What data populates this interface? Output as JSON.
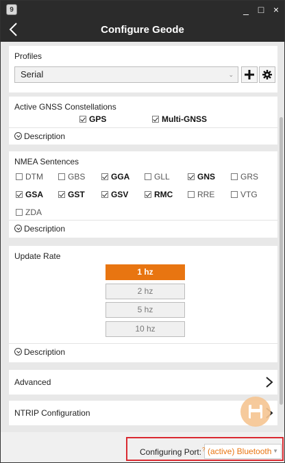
{
  "window": {
    "title": "Configure Geode",
    "app_icon_label": "9",
    "minimize": "_",
    "maximize": "□",
    "close": "×"
  },
  "profiles": {
    "title": "Profiles",
    "selected": "Serial"
  },
  "gnss": {
    "title": "Active GNSS Constellations",
    "options": [
      {
        "label": "GPS",
        "checked": true
      },
      {
        "label": "Multi-GNSS",
        "checked": true
      }
    ],
    "description": "Description"
  },
  "nmea": {
    "title": "NMEA Sentences",
    "options": [
      {
        "label": "DTM",
        "checked": false
      },
      {
        "label": "GBS",
        "checked": false
      },
      {
        "label": "GGA",
        "checked": true
      },
      {
        "label": "GLL",
        "checked": false
      },
      {
        "label": "GNS",
        "checked": true
      },
      {
        "label": "GRS",
        "checked": false
      },
      {
        "label": "GSA",
        "checked": true
      },
      {
        "label": "GST",
        "checked": true
      },
      {
        "label": "GSV",
        "checked": true
      },
      {
        "label": "RMC",
        "checked": true
      },
      {
        "label": "RRE",
        "checked": false
      },
      {
        "label": "VTG",
        "checked": false
      },
      {
        "label": "ZDA",
        "checked": false
      }
    ],
    "description": "Description"
  },
  "update_rate": {
    "title": "Update Rate",
    "options": [
      "1 hz",
      "2 hz",
      "5 hz",
      "10 hz"
    ],
    "active": "1 hz",
    "description": "Description"
  },
  "advanced": {
    "label": "Advanced"
  },
  "ntrip": {
    "label": "NTRIP Configuration"
  },
  "footer": {
    "label": "Configuring Port:",
    "port_value": "(active) Bluetooth",
    "superscript": "?"
  },
  "colors": {
    "accent": "#e87511",
    "titlebar": "#2b2b2b",
    "highlight": "#d9282f"
  }
}
